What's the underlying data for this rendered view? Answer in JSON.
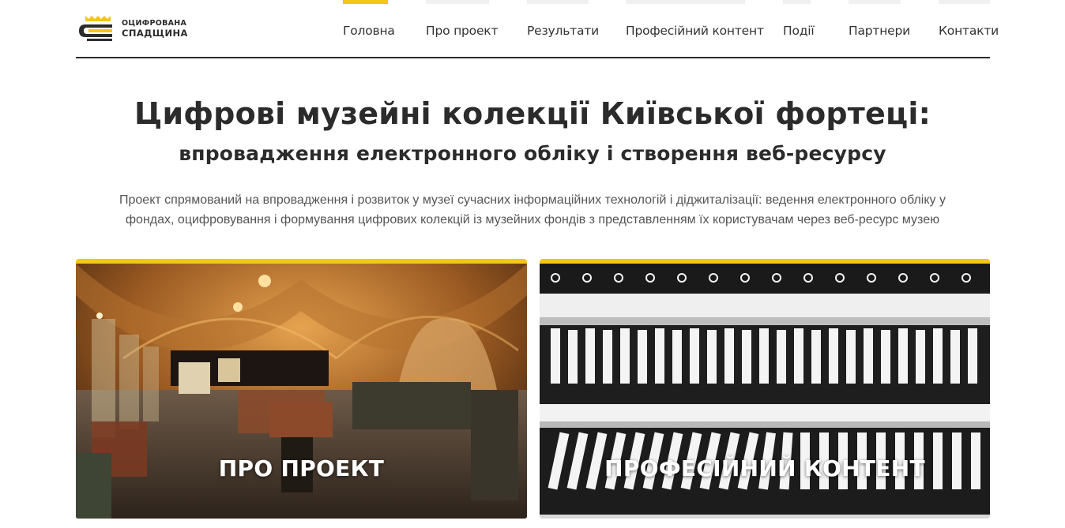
{
  "logo": {
    "line1": "ОЦИФРОВАНА",
    "line2": "СПАДЩИНА"
  },
  "nav": [
    {
      "label": "Головна",
      "active": true
    },
    {
      "label": "Про проект",
      "active": false
    },
    {
      "label": "Результати",
      "active": false
    },
    {
      "label": "Професійний контент",
      "active": false
    },
    {
      "label": "Події",
      "active": false
    },
    {
      "label": "Партнери",
      "active": false
    },
    {
      "label": "Контакти",
      "active": false
    }
  ],
  "hero": {
    "title": "Цифрові музейні колекції Київської фортеці:",
    "subtitle": "впровадження електронного обліку і створення веб-ресурсу",
    "description": "Проект спрямований на впровадження і розвиток у музеї сучасних інформаційних технологій і діджиталізації: ведення електронного обліку у фондах, оцифровування і формування цифрових колекцій із музейних фондів з представленням їх користувачам через веб-ресурс музею"
  },
  "cards": [
    {
      "label": "ПРО ПРОЕКТ",
      "image": "museum-vaulted-hall-photo"
    },
    {
      "label": "ПРОФЕСІЙНИЙ КОНТЕНТ",
      "image": "archive-binders-shelves-photo"
    }
  ],
  "colors": {
    "accent": "#f5c518",
    "text": "#2b2b2b",
    "muted": "#555555"
  }
}
